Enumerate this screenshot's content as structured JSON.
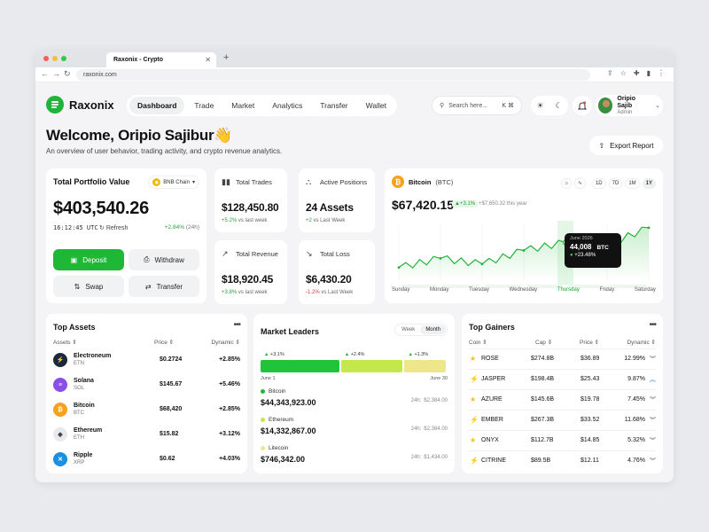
{
  "browser": {
    "tab_title": "Raxonix - Crypto",
    "url": "raxonix.com"
  },
  "brand": {
    "name": "Raxonix",
    "accent": "#1fb736"
  },
  "nav": [
    {
      "label": "Dashboard",
      "active": true
    },
    {
      "label": "Trade"
    },
    {
      "label": "Market"
    },
    {
      "label": "Analytics"
    },
    {
      "label": "Transfer"
    },
    {
      "label": "Wallet"
    }
  ],
  "search": {
    "placeholder": "Search here...",
    "shortcut": "K ⌘"
  },
  "user": {
    "name": "Oripio Sajib",
    "role": "Admin"
  },
  "header": {
    "welcome": "Welcome, Oripio Sajibur👋",
    "subtitle": "An overview of user behavior, trading activity, and crypto revenue analytics.",
    "export_label": "Export Report"
  },
  "portfolio": {
    "title": "Total Portfolio Value",
    "chain": "BNB Chain",
    "value": "$403,540.26",
    "time": "16:12:45 UTC",
    "refresh": "Refresh",
    "change": "+2.84%",
    "change_period": "(24h)",
    "deposit": "Deposit",
    "withdraw": "Withdraw",
    "swap": "Swap",
    "transfer": "Transfer"
  },
  "stats": {
    "trades": {
      "label": "Total Trades",
      "value": "$128,450.80",
      "change": "+5.2%",
      "note": "vs last week"
    },
    "positions": {
      "label": "Active Positions",
      "value": "24 Assets",
      "change": "+2",
      "note": "vs Last Week"
    },
    "revenue": {
      "label": "Total Revenue",
      "value": "$18,920.45",
      "change": "+3.8%",
      "note": "vs last week"
    },
    "loss": {
      "label": "Total Loss",
      "value": "$6,430.20",
      "change": "-1.2%",
      "note": "vs Last Week"
    }
  },
  "bitcoin": {
    "name": "Bitcoin",
    "symbol": "(BTC)",
    "value": "$67,420.15",
    "change": "+3.1%",
    "note": "+$7,650.32 this year",
    "ranges": [
      "1D",
      "7D",
      "1M",
      "1Y"
    ],
    "active_range": "1Y",
    "days": [
      "Sunday",
      "Monday",
      "Tuesday",
      "Wednesday",
      "Thursday",
      "Friday",
      "Saturday"
    ],
    "highlight_day": "Thursday",
    "tooltip": {
      "date": "June 2026",
      "value": "44,008",
      "unit": "BTC",
      "change": "+23.48%"
    }
  },
  "chart_data": {
    "type": "line",
    "x": [
      "Sunday",
      "Monday",
      "Tuesday",
      "Wednesday",
      "Thursday",
      "Friday",
      "Saturday"
    ],
    "series": [
      {
        "values": [
          22,
          30,
          25,
          37,
          44,
          42,
          57
        ]
      }
    ]
  },
  "top_assets": {
    "title": "Top Assets",
    "col_asset": "Assets ⇕",
    "col_price": "Price ⇕",
    "col_dynamic": "Dynamic ⇕",
    "rows": [
      {
        "name": "Electroneum",
        "symbol": "ETN",
        "price": "$0.2724",
        "dynamic": "+2.85%",
        "icon": "electroneum-icon",
        "color": "#1a2a3a",
        "glyph": "⚡"
      },
      {
        "name": "Solana",
        "symbol": "SOL",
        "price": "$145.67",
        "dynamic": "+5.46%",
        "icon": "solana-icon",
        "color": "#8b4fe8",
        "glyph": "≡"
      },
      {
        "name": "Bitcoin",
        "symbol": "BTC",
        "price": "$68,420",
        "dynamic": "+2.85%",
        "icon": "bitcoin-icon",
        "color": "#f7a21b",
        "glyph": "₿"
      },
      {
        "name": "Ethereum",
        "symbol": "ETH",
        "price": "$15.82",
        "dynamic": "+3.12%",
        "icon": "ethereum-icon",
        "color": "#e8e9ec",
        "glyph": "◆"
      },
      {
        "name": "Ripple",
        "symbol": "XRP",
        "price": "$0.62",
        "dynamic": "+4.03%",
        "icon": "ripple-icon",
        "color": "#1e8fe0",
        "glyph": "✕"
      }
    ]
  },
  "market_leaders": {
    "title": "Market Leaders",
    "tabs": [
      "Week",
      "Month"
    ],
    "active_tab": "Month",
    "bars": [
      {
        "pct": "+3.1%",
        "share": 0.43,
        "color": "#1fc43a"
      },
      {
        "pct": "+2.4%",
        "share": 0.34,
        "color": "#c4e84a"
      },
      {
        "pct": "+1.3%",
        "share": 0.23,
        "color": "#eee68a"
      }
    ],
    "start": "June 1",
    "end": "June 30",
    "rows": [
      {
        "name": "Bitcoin",
        "value": "$44,343,923.00",
        "period": "24h:",
        "delta": "$2,384.00",
        "color": "#1fb736"
      },
      {
        "name": "Ethereum",
        "value": "$14,332,867.00",
        "period": "24h:",
        "delta": "$2,384.00",
        "color": "#c4e84a"
      },
      {
        "name": "Litecoin",
        "value": "$746,342.00",
        "period": "24h:",
        "delta": "$1,434.00",
        "color": "#eee68a"
      }
    ]
  },
  "top_gainers": {
    "title": "Top Gainers",
    "col_coin": "Coin ⇕",
    "col_cap": "Cap ⇕",
    "col_price": "Price ⇕",
    "col_dynamic": "Dynamic ⇕",
    "rows": [
      {
        "name": "ROSE",
        "cap": "$274.8B",
        "price": "$36.89",
        "dynamic": "12.99%",
        "icon": "star-icon",
        "glyph": "★",
        "color": "#f2c21b",
        "dir": "down"
      },
      {
        "name": "JASPER",
        "cap": "$198.4B",
        "price": "$25.43",
        "dynamic": "9.87%",
        "icon": "bolt-icon",
        "glyph": "⚡",
        "color": "#e84a5f",
        "dir": "up"
      },
      {
        "name": "AZURE",
        "cap": "$145.6B",
        "price": "$19.78",
        "dynamic": "7.45%",
        "icon": "star-icon",
        "glyph": "★",
        "color": "#f2c21b",
        "dir": "down"
      },
      {
        "name": "EMBER",
        "cap": "$267.3B",
        "price": "$33.52",
        "dynamic": "11.68%",
        "icon": "bolt-icon",
        "glyph": "⚡",
        "color": "#e84a5f",
        "dir": "down"
      },
      {
        "name": "ONYX",
        "cap": "$112.7B",
        "price": "$14.85",
        "dynamic": "5.32%",
        "icon": "star-icon",
        "glyph": "★",
        "color": "#f2c21b",
        "dir": "down"
      },
      {
        "name": "CITRINE",
        "cap": "$89.5B",
        "price": "$12.11",
        "dynamic": "4.76%",
        "icon": "bolt-icon",
        "glyph": "⚡",
        "color": "#e84a5f",
        "dir": "down"
      }
    ]
  }
}
